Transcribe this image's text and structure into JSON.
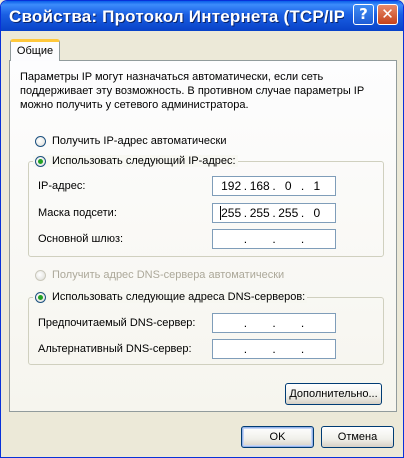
{
  "window": {
    "title": "Свойства: Протокол Интернета (TCP/IP)",
    "help_glyph": "?",
    "close_glyph": "✕"
  },
  "tab": {
    "label": "Общие"
  },
  "description": "Параметры IP могут назначаться автоматически, если сеть поддерживает эту возможность. В противном случае параметры IP можно получить у сетевого администратора.",
  "ip_mode": {
    "auto_label": "Получить IP-адрес автоматически",
    "manual_label": "Использовать следующий IP-адрес:",
    "selected": "manual"
  },
  "ip_fields": {
    "ip_label": "IP-адрес:",
    "ip_value": [
      "192",
      "168",
      "0",
      "1"
    ],
    "mask_label": "Маска подсети:",
    "mask_value": [
      "255",
      "255",
      "255",
      "0"
    ],
    "gateway_label": "Основной шлюз:",
    "gateway_value": [
      "",
      "",
      "",
      ""
    ]
  },
  "dns_mode": {
    "auto_label": "Получить адрес DNS-сервера автоматически",
    "manual_label": "Использовать следующие адреса DNS-серверов:",
    "selected": "manual"
  },
  "dns_fields": {
    "preferred_label": "Предпочитаемый DNS-сервер:",
    "preferred_value": [
      "",
      "",
      "",
      ""
    ],
    "alternate_label": "Альтернативный DNS-сервер:",
    "alternate_value": [
      "",
      "",
      "",
      ""
    ]
  },
  "buttons": {
    "advanced": "Дополнительно...",
    "ok": "OK",
    "cancel": "Отмена"
  },
  "dot": "."
}
